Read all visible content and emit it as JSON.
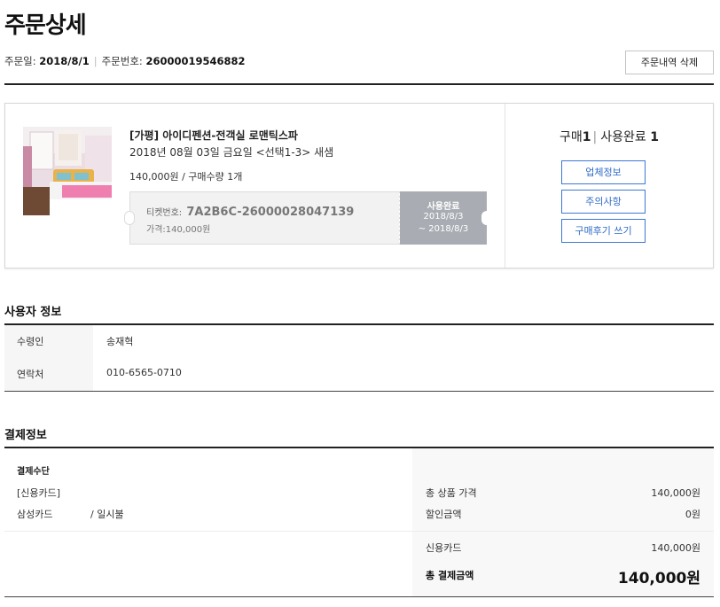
{
  "header": {
    "title": "주문상세",
    "order_date_label": "주문일:",
    "order_date": "2018/8/1",
    "order_no_label": "주문번호:",
    "order_no": "26000019546882",
    "delete_button": "주문내역 삭제"
  },
  "order_item": {
    "name": "[가평] 아이디펜션-전객실 로맨틱스파",
    "date_option": "2018년 08월 03일 금요일 <선택1-3> 새샘",
    "price_qty": "140,000원 / 구매수량 1개",
    "ticket": {
      "number_label": "티켓번호:",
      "number": "7A2B6C-26000028047139",
      "price": "가격:140,000원",
      "status": "사용완료",
      "valid_from": "2018/8/3",
      "valid_to": "~ 2018/8/3"
    },
    "summary": {
      "purchase_label": "구매",
      "purchase_count": "1",
      "used_label": "사용완료",
      "used_count": "1"
    },
    "buttons": {
      "vendor_info": "업체정보",
      "notice": "주의사항",
      "write_review": "구매후기 쓰기"
    }
  },
  "user_info": {
    "title": "사용자 정보",
    "recipient_label": "수령인",
    "recipient": "송재혁",
    "contact_label": "연락처",
    "contact": "010-6565-0710"
  },
  "payment": {
    "title": "결제정보",
    "method_title": "결제수단",
    "method_type": "[신용카드]",
    "card_name": "삼성카드",
    "installment": "/ 일시불",
    "total_goods_label": "총 상품 가격",
    "total_goods": "140,000원",
    "discount_label": "할인금액",
    "discount": "0원",
    "credit_label": "신용카드",
    "credit": "140,000원",
    "total_label": "총 결제금액",
    "total": "140,000원"
  },
  "colors": {
    "accent_blue": "#2f6cc8",
    "ticket_status_bg": "#a9adb3"
  }
}
